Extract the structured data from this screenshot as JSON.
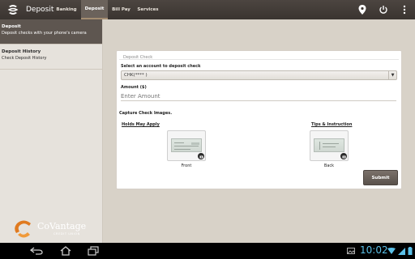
{
  "app": {
    "title": "Deposit"
  },
  "tabs": [
    {
      "label": "Banking",
      "active": false
    },
    {
      "label": "Deposit",
      "active": true
    },
    {
      "label": "Bill Pay",
      "active": false
    },
    {
      "label": "Services",
      "active": false
    }
  ],
  "topbar_icons": [
    "location-icon",
    "power-icon",
    "overflow-menu-icon"
  ],
  "sidebar": {
    "items": [
      {
        "title": "Deposit",
        "subtitle": "Deposit checks with your phone's camera",
        "active": true
      },
      {
        "title": "Deposit History",
        "subtitle": "Check Deposit History",
        "active": false
      }
    ],
    "logo": {
      "name": "CoVantage",
      "tagline": "CREDIT UNION"
    }
  },
  "form": {
    "section_title": "Deposit Check",
    "account_label": "Select an account to deposit check",
    "account_value": "CHK(****         )",
    "amount_label": "Amount ($)",
    "amount_placeholder": "Enter Amount",
    "capture_label": "Capture Check Images.",
    "holds_link": "Holds May Apply",
    "tips_link": "Tips & Instruction",
    "front_caption": "Front",
    "back_caption": "Back",
    "submit_label": "Submit"
  },
  "system": {
    "time": "10:02"
  },
  "colors": {
    "topbar": "#3f3833",
    "accent_tab": "#6b625b",
    "clock": "#5bc0e8",
    "background": "#d8d2c8"
  }
}
